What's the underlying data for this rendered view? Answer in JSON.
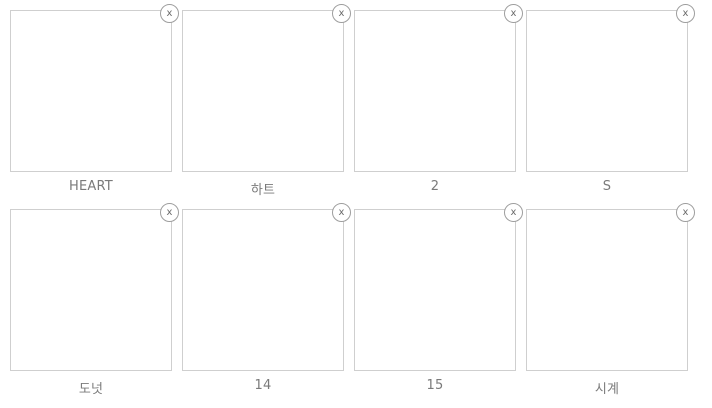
{
  "remove_icon_glyph": "x",
  "items": [
    {
      "label": "HEART"
    },
    {
      "label": "하트"
    },
    {
      "label": "2"
    },
    {
      "label": "S"
    },
    {
      "label": "도넛"
    },
    {
      "label": "14"
    },
    {
      "label": "15"
    },
    {
      "label": "시계"
    }
  ]
}
